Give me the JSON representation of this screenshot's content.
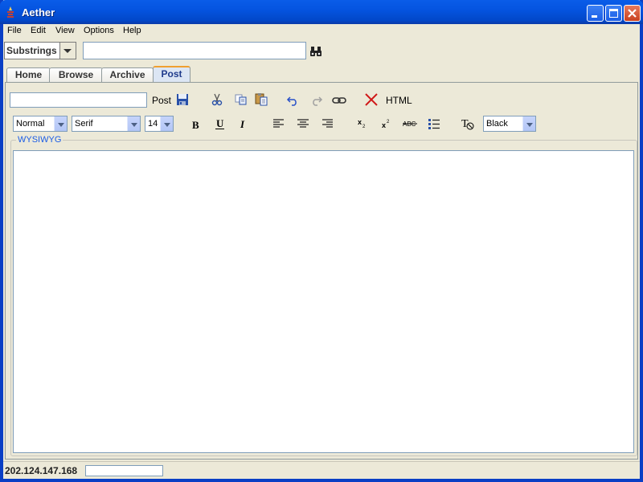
{
  "window": {
    "title": "Aether"
  },
  "menu": [
    "File",
    "Edit",
    "View",
    "Options",
    "Help"
  ],
  "search": {
    "mode": "Substrings",
    "query": ""
  },
  "tabs": [
    "Home",
    "Browse",
    "Archive",
    "Post"
  ],
  "active_tab": "Post",
  "post": {
    "title_value": "",
    "post_label": "Post",
    "html_label": "HTML",
    "style": "Normal",
    "font": "Serif",
    "size": "14",
    "color": "Black",
    "panel_label": "WYSIWYG",
    "body": ""
  },
  "status": {
    "ip": "202.124.147.168",
    "progress": 0
  },
  "icons": [
    "app-icon",
    "binoculars-icon",
    "save-icon",
    "cut-icon",
    "copy-icon",
    "paste-icon",
    "undo-icon",
    "redo-icon",
    "link-icon",
    "delete-icon",
    "bold-icon",
    "underline-icon",
    "italic-icon",
    "align-left-icon",
    "align-center-icon",
    "align-right-icon",
    "subscript-icon",
    "superscript-icon",
    "strikethrough-icon",
    "bullet-list-icon",
    "clear-format-icon"
  ]
}
